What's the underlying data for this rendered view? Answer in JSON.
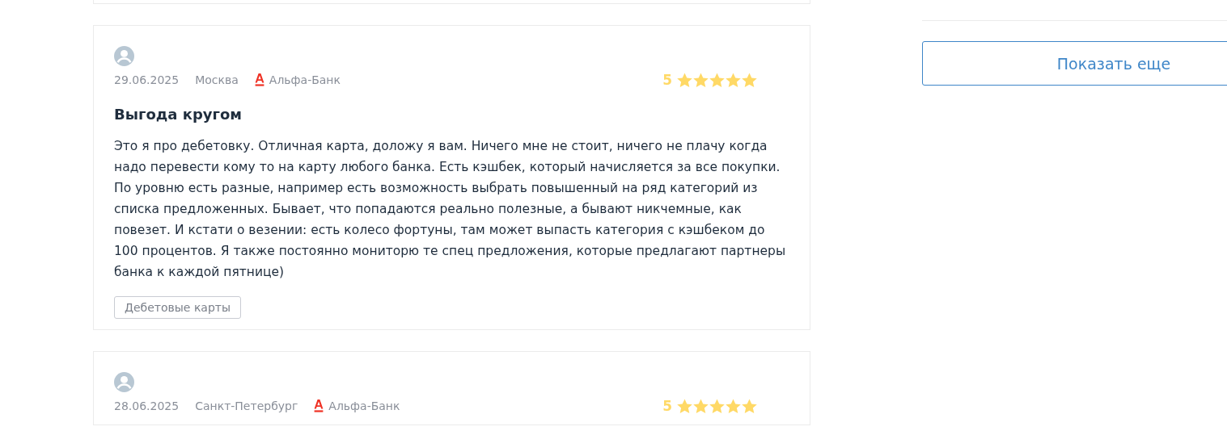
{
  "reviews": [
    {
      "date": "29.06.2025",
      "city": "Москва",
      "bank": "Альфа-Банк",
      "rating": "5",
      "stars": 5,
      "title": "Выгода кругом",
      "text": "Это я про дебетовку. Отличная карта, доложу я вам. Ничего мне не стоит, ничего не плачу когда надо перевести кому то на карту любого банка. Есть кэшбек, который начисляется за все покупки. По уровню есть разные, например есть возможность выбрать повышенный на ряд категорий из списка предложенных. Бывает, что попадаются реально полезные, а бывают никчемные, как повезет. И кстати о везении: есть колесо фортуны, там может выпасть категория с кэшбеком до 100 процентов. Я также постоянно мониторю те спец предложения, которые предлагают партнеры банка к каждой пятнице)",
      "tags": [
        "Дебетовые карты"
      ]
    },
    {
      "date": "28.06.2025",
      "city": "Санкт-Петербург",
      "bank": "Альфа-Банк",
      "rating": "5",
      "stars": 5
    }
  ],
  "sidebar": {
    "show_more_button": "Показать еще"
  }
}
